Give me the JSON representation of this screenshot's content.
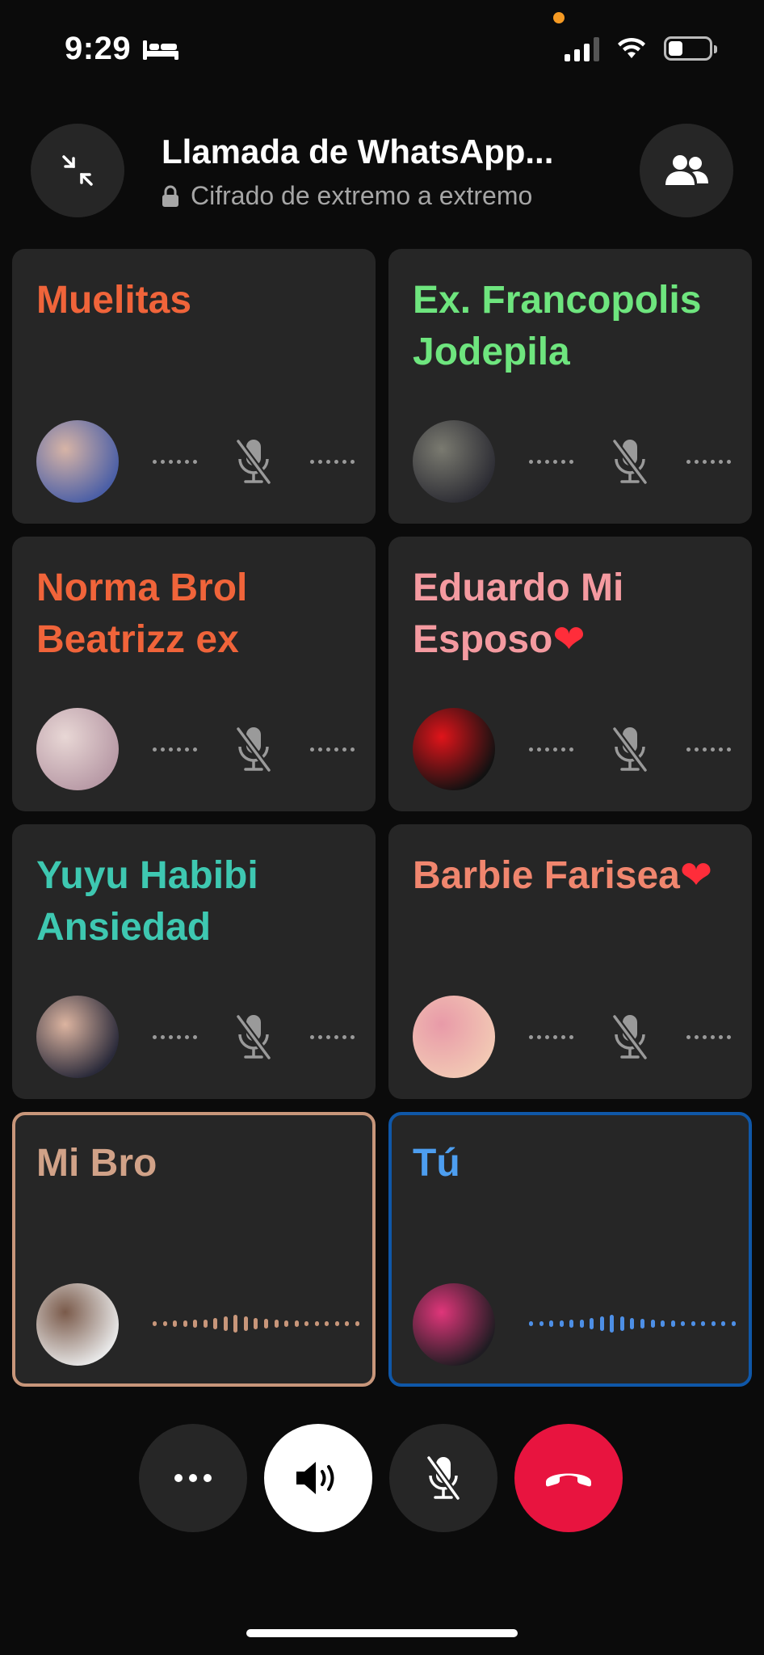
{
  "status_bar": {
    "time": "9:29",
    "focus_icon": "bed-icon",
    "signal_icon": "cellular-signal-icon",
    "wifi_icon": "wifi-icon",
    "battery_icon": "battery-icon",
    "battery_level": 0.35,
    "privacy_dot_color": "#f59a23"
  },
  "header": {
    "title": "Llamada de WhatsApp...",
    "subtitle": "Cifrado de extremo a extremo",
    "minimize_icon": "minimize-arrows-icon",
    "participants_icon": "participants-icon",
    "lock_icon": "lock-icon"
  },
  "participants": [
    {
      "name": "Muelitas",
      "name_color": "#f0643a",
      "muted": true,
      "avatar_colors": [
        "#4b5fa6",
        "#d7b4a6"
      ]
    },
    {
      "name": "Ex. Francopolis Jodepila",
      "name_color": "#6ee57e",
      "muted": true,
      "avatar_colors": [
        "#2d2d34",
        "#7a7a70"
      ]
    },
    {
      "name": "Norma Brol Beatrizz ex",
      "name_color": "#f0643a",
      "muted": true,
      "avatar_colors": [
        "#b89aa6",
        "#e8d7d5"
      ]
    },
    {
      "name": "Eduardo Mi Esposo",
      "heart": "❤",
      "name_color": "#f49aa0",
      "muted": true,
      "avatar_colors": [
        "#111111",
        "#e0141a"
      ]
    },
    {
      "name": "Yuyu Habibi Ansiedad",
      "name_color": "#3ec8b1",
      "muted": true,
      "avatar_colors": [
        "#2a2a3a",
        "#dcb4a0"
      ]
    },
    {
      "name": "Barbie Farisea",
      "heart": "❤",
      "name_color": "#f0866e",
      "muted": true,
      "avatar_colors": [
        "#f2c8b4",
        "#e89aa8"
      ]
    },
    {
      "name": "Mi Bro",
      "name_color": "#d1a288",
      "muted": false,
      "speaking": true,
      "border_color": "#c8967a",
      "wave_color": "#c8967a",
      "avatar_colors": [
        "#e8e8e8",
        "#7a5a4a"
      ]
    },
    {
      "name": "Tú",
      "name_color": "#4d9ef0",
      "muted": false,
      "speaking": true,
      "border_color": "#0f57a8",
      "wave_color": "#4d8fe6",
      "avatar_colors": [
        "#1f1c22",
        "#e0367a"
      ]
    }
  ],
  "controls": {
    "more_icon": "more-options-icon",
    "speaker_icon": "speaker-icon",
    "mute_icon": "mic-off-icon",
    "end_call_icon": "end-call-icon",
    "end_call_color": "#e8143f"
  }
}
